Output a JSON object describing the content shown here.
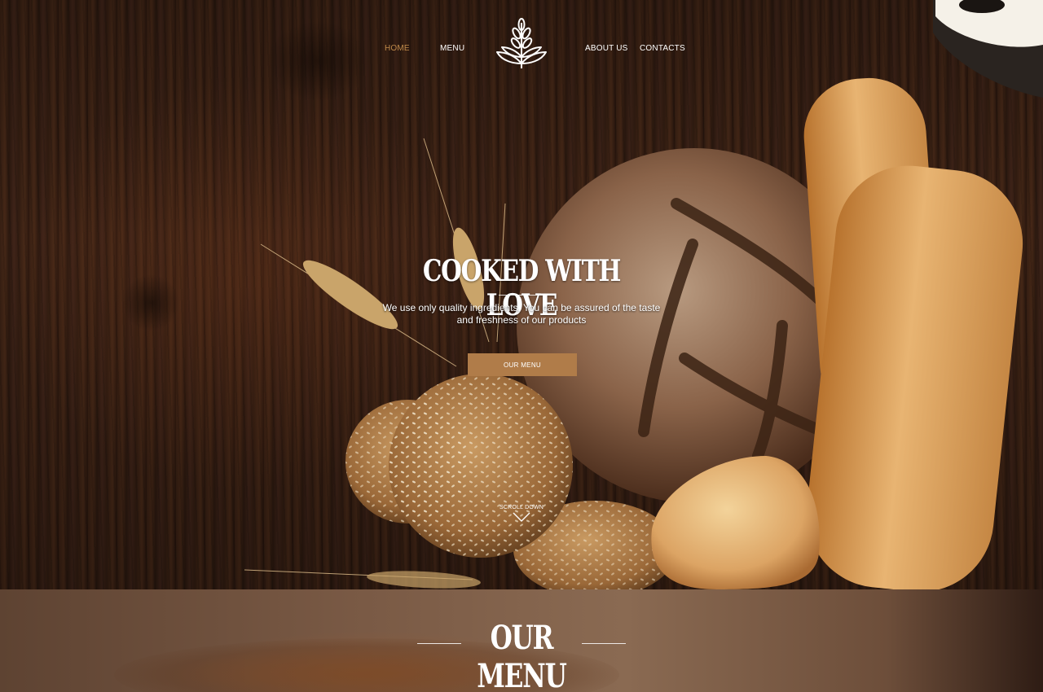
{
  "nav": {
    "home": "HOME",
    "menu": "MENU",
    "about": "ABOUT US",
    "contacts": "CONTACTS",
    "active_color": "#c08a4a"
  },
  "logo": {
    "icon": "wheat-icon"
  },
  "hero": {
    "title": "COOKED WITH LOVE",
    "subtitle_line1": "We use only quality ingredients. You can be assured of the taste",
    "subtitle_line2": "and freshness of our products",
    "cta_label": "OUR MENU",
    "cta_color": "#b07c49",
    "scroll_label": "SCROLL DOWN",
    "scroll_icon": "chevron-down-icon"
  },
  "menu_section": {
    "title": "OUR MENU"
  }
}
